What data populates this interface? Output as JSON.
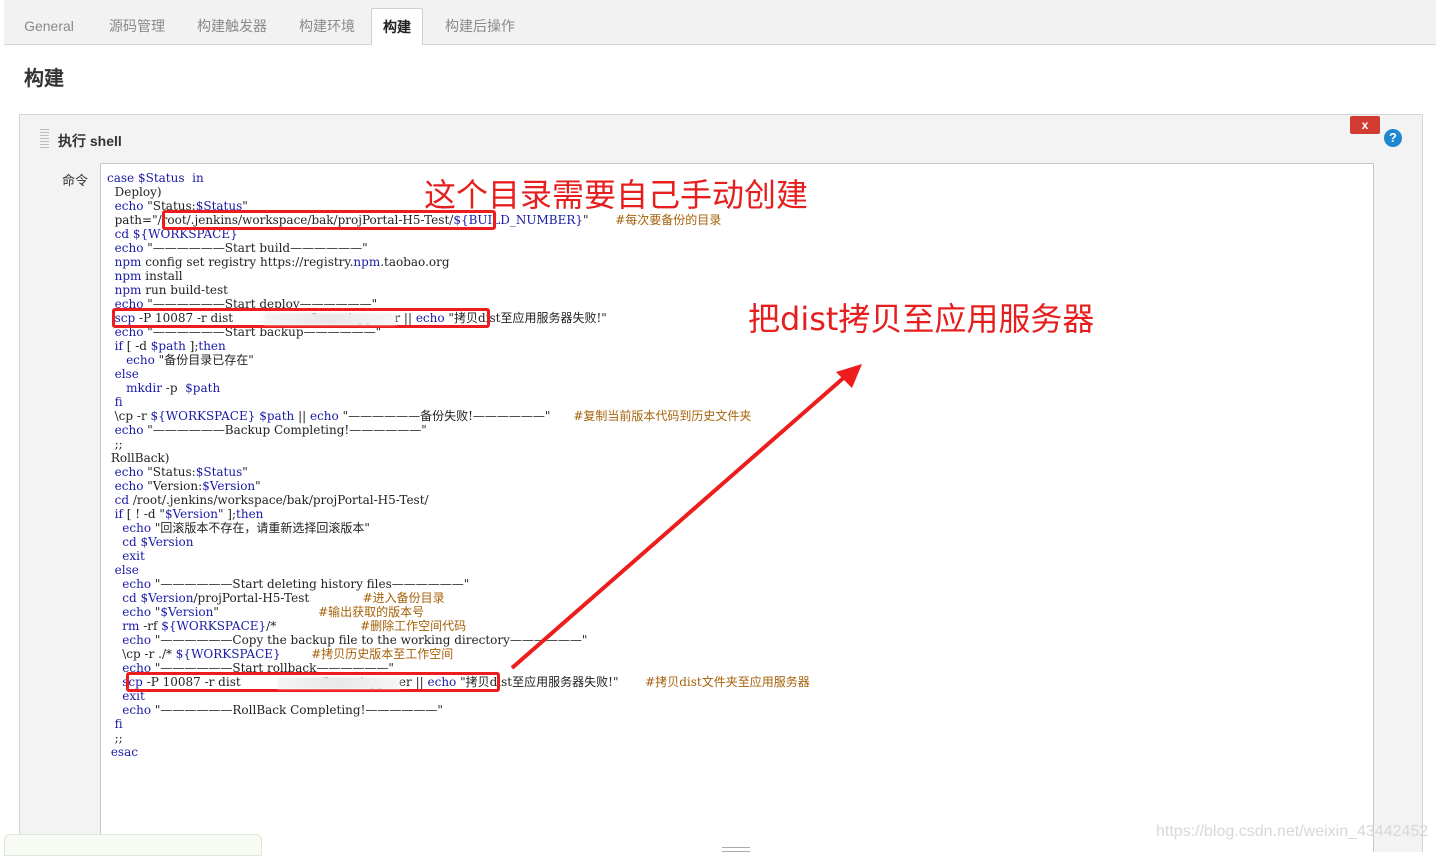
{
  "tabs": [
    {
      "label": "General"
    },
    {
      "label": "源码管理"
    },
    {
      "label": "构建触发器"
    },
    {
      "label": "构建环境"
    },
    {
      "label": "构建"
    },
    {
      "label": "构建后操作"
    }
  ],
  "section_title": "构建",
  "step": {
    "title": "执行 shell",
    "close_label": "x",
    "help_label": "?",
    "command_label": "命令"
  },
  "code_lines": [
    "case $Status  in",
    "  Deploy)",
    "  echo \"Status:$Status\"",
    "  path=\"/root/.jenkins/workspace/bak/projPortal-H5-Test/${BUILD_NUMBER}\"       #每次要备份的目录",
    "  cd ${WORKSPACE}",
    "  echo \"——————Start build——————\"",
    "  npm config set registry https://registry.npm.taobao.org",
    "  npm install",
    "  npm run build-test",
    "  echo \"——————Start deploy——————\"",
    "  scp -P 10087 -r dist                    /home/appuser || echo \"拷贝dist至应用服务器失败!\"",
    "  echo \"——————Start backup——————\"",
    "  if [ -d $path ];then",
    "     echo \"备份目录已存在\"",
    "  else",
    "     mkdir -p  $path",
    "  fi",
    "  \\cp -r ${WORKSPACE} $path || echo \"——————备份失败!——————\"      #复制当前版本代码到历史文件夹",
    "  echo \"——————Backup Completing!——————\"",
    "  ;;",
    " RollBack)",
    "  echo \"Status:$Status\"",
    "  echo \"Version:$Version\"",
    "  cd /root/.jenkins/workspace/bak/projPortal-H5-Test/",
    "  if [ ! -d \"$Version\" ];then",
    "    echo \"回滚版本不存在，请重新选择回滚版本\"",
    "    cd $Version",
    "    exit",
    "  else",
    "    echo \"——————Start deleting history files——————\"",
    "    cd $Version/projPortal-H5-Test              #进入备份目录",
    "    echo \"$Version\"                          #输出获取的版本号",
    "    rm -rf ${WORKSPACE}/*                      #删除工作空间代码",
    "    echo \"——————Copy the backup file to the working directory——————\"",
    "    \\cp -r ./* ${WORKSPACE}        #拷贝历史版本至工作空间",
    "    echo \"——————Start rollback——————\"",
    "    scp -P 10087 -r dist                    :/home/appuser || echo \"拷贝dist至应用服务器失败!\"       #拷贝dist文件夹至应用服务器",
    "    exit",
    "    echo \"——————RollBack Completing!——————\"",
    "  fi",
    "  ;;",
    " esac"
  ],
  "annotations": {
    "top": "这个目录需要自己手动创建",
    "middle": "把dist拷贝至应用服务器"
  },
  "colors": {
    "annotation": "#e61e1e",
    "keyword": "#1a1aa6",
    "comment": "#a5620a"
  },
  "watermark": "https://blog.csdn.net/weixin_43442452"
}
